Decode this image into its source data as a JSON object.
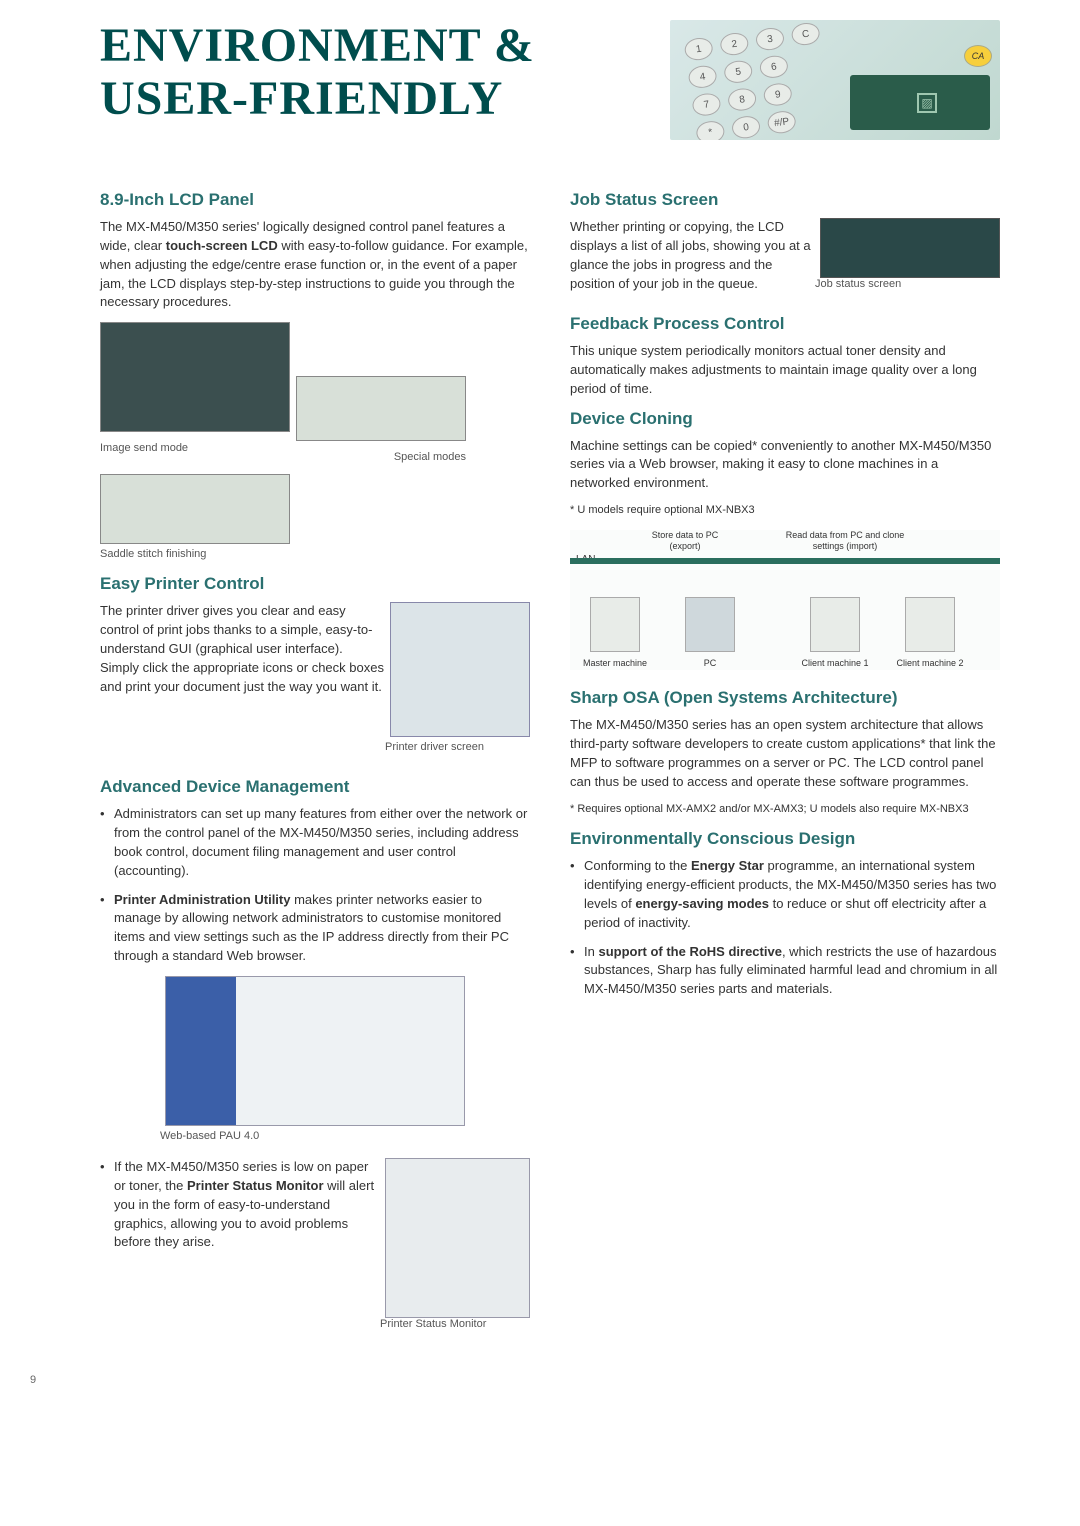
{
  "title_line1": "ENVIRONMENT &",
  "title_line2": "USER-FRIENDLY",
  "page_number": "9",
  "hero": {
    "keys": [
      "1",
      "2",
      "3",
      "C",
      "4",
      "5",
      "6",
      "",
      "7",
      "8",
      "9",
      "CA",
      "*",
      "0",
      "#/P",
      ""
    ],
    "ca": "CA"
  },
  "left": {
    "lcd": {
      "heading": "8.9-Inch LCD Panel",
      "p1_a": "The MX-M450/M350 series' logically designed control panel features a wide, clear ",
      "p1_b": "touch-screen LCD",
      "p1_c": " with easy-to-follow guidance. For example, when adjusting the edge/centre erase function or, in the event of a paper jam, the LCD displays step-by-step instructions to guide you through the necessary procedures.",
      "cap_send": "Image send mode",
      "cap_special": "Special modes",
      "cap_saddle": "Saddle stitch finishing"
    },
    "easy": {
      "heading": "Easy Printer Control",
      "p1": "The printer driver gives you clear and easy control of print jobs thanks to a simple, easy-to-understand GUI (graphical user interface). Simply click the appropriate icons or check boxes and print your document just the way you want it.",
      "cap": "Printer driver screen"
    },
    "adm": {
      "heading": "Advanced Device Management",
      "b1": "Administrators can set up many features from either over the network or from the control panel of the MX-M450/M350 series, including address book control, document filing management and user control (accounting).",
      "b2_bold": "Printer Administration Utility",
      "b2_rest": " makes printer networks easier to manage by allowing network administrators to customise monitored items and view settings such as the IP address directly from their PC through a standard Web browser.",
      "cap_pau": "Web-based PAU 4.0",
      "b3_a": "If the MX-M450/M350 series is low on paper or toner, the ",
      "b3_bold": "Printer Status Monitor",
      "b3_c": " will alert you in the form of easy-to-understand graphics, allowing you to avoid problems before they arise.",
      "cap_psm": "Printer Status Monitor"
    }
  },
  "right": {
    "job": {
      "heading": "Job Status Screen",
      "p1": "Whether printing or copying, the LCD displays a list of all jobs, showing you at a glance the jobs in progress and the position of your job in the queue.",
      "cap": "Job status screen"
    },
    "feedback": {
      "heading": "Feedback Process Control",
      "p1": "This unique system periodically monitors actual toner density and automatically makes adjustments to maintain image quality over a long period of time."
    },
    "cloning": {
      "heading": "Device Cloning",
      "p1": "Machine settings can be copied* conveniently to another MX-M450/M350 series via a Web browser, making it easy to clone machines in a networked environment.",
      "foot": "* U models require optional MX-NBX3",
      "lan": "LAN",
      "store": "Store data to PC (export)",
      "read": "Read data from PC and clone settings (import)",
      "m1": "Master machine",
      "m2": "PC",
      "m3": "Client machine 1",
      "m4": "Client machine 2"
    },
    "osa": {
      "heading": "Sharp OSA (Open Systems Architecture)",
      "p1": "The MX-M450/M350 series has an open system architecture that allows third-party software developers to create custom applications* that link the MFP to software programmes on a server or PC. The LCD control panel can thus be used to access and operate these software programmes.",
      "foot": "* Requires optional MX-AMX2 and/or MX-AMX3; U models also require MX-NBX3"
    },
    "env": {
      "heading": "Environmentally Conscious Design",
      "b1_a": "Conforming to the ",
      "b1_bold": "Energy Star",
      "b1_b": " programme, an international system identifying energy-efficient products, the MX-M450/M350 series has two levels of ",
      "b1_bold2": "energy-saving modes",
      "b1_c": " to reduce or shut off electricity after a period of inactivity.",
      "b2_a": "In ",
      "b2_bold": "support of the RoHS directive",
      "b2_b": ", which restricts the use of hazardous substances, Sharp has fully eliminated harmful lead and chromium in all MX-M450/M350 series parts and materials."
    }
  }
}
